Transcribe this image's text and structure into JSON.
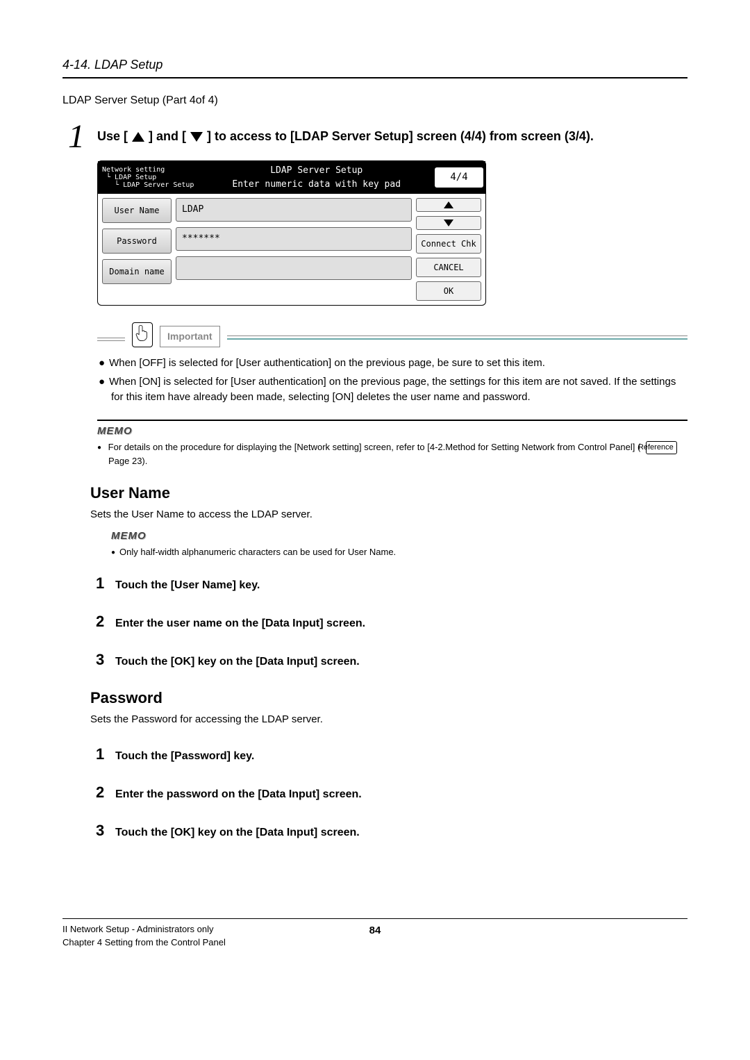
{
  "header": {
    "section": "4-14. LDAP Setup"
  },
  "subtitle": "LDAP Server Setup (Part 4of 4)",
  "step1": {
    "pre": "Use [",
    "mid": "] and [",
    "post": "] to access to [LDAP Server Setup] screen (4/4) from screen (3/4)."
  },
  "screenshot": {
    "breadcrumb": "Network setting\n └ LDAP Setup\n   └ LDAP Server Setup",
    "title_line1": "LDAP Server Setup",
    "title_line2": "Enter numeric data with key pad",
    "page_indicator": "4/4",
    "left_buttons": [
      "User Name",
      "Password",
      "Domain name"
    ],
    "fields": [
      "LDAP",
      "*******",
      ""
    ],
    "right_buttons": {
      "connect": "Connect Chk",
      "cancel": "CANCEL",
      "ok": "OK"
    }
  },
  "important": {
    "label": "Important",
    "items": [
      "When [OFF] is selected for [User authentication] on the previous page, be sure to set this item.",
      "When [ON] is selected for [User authentication] on the previous page, the settings for this item are not saved. If the settings for this item have already been made, selecting [ON] deletes the user name and password."
    ]
  },
  "memo1": {
    "title": "MEMO",
    "text_pre": "For details on the procedure for displaying the [Network setting] screen, refer to [4-2.Method for Setting Network from Control Panel] (",
    "ref": "Reference",
    "text_post": " Page 23)."
  },
  "username": {
    "heading": "User Name",
    "desc": "Sets the User Name to access the LDAP server.",
    "memo_title": "MEMO",
    "memo_item": "Only half-width alphanumeric characters can be used for User Name.",
    "steps": [
      "Touch the [User Name] key.",
      "Enter the user name on the [Data Input] screen.",
      "Touch the [OK] key on the [Data Input] screen."
    ]
  },
  "password": {
    "heading": "Password",
    "desc": "Sets the Password for accessing the LDAP server.",
    "steps": [
      "Touch the [Password] key.",
      "Enter the password on the [Data Input] screen.",
      "Touch the [OK] key on the [Data Input] screen."
    ]
  },
  "footer": {
    "line1": "II Network Setup - Administrators only",
    "line2": "Chapter 4 Setting from the Control Panel",
    "page": "84"
  }
}
